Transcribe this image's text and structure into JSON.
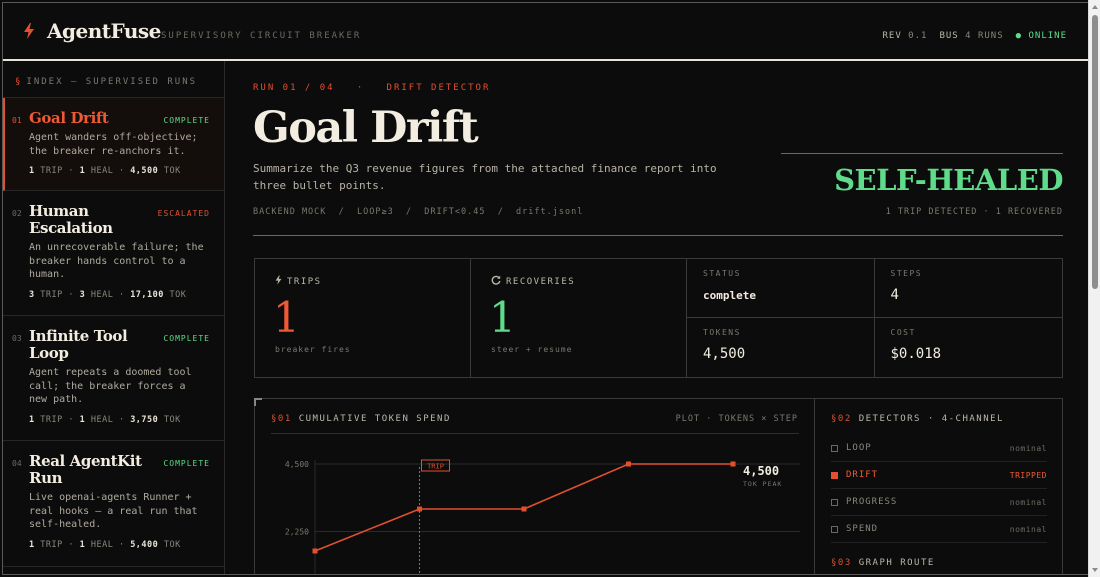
{
  "header": {
    "brand": "AgentFuse",
    "tagline": "SUPERVISORY CIRCUIT BREAKER",
    "rev_label": "REV",
    "rev_value": "0.1",
    "bus_label": "BUS",
    "bus_value": "4 RUNS",
    "status": "● ONLINE",
    "logo_icon": "bolt-icon",
    "accent": "#e2502e"
  },
  "sidebar": {
    "title": "INDEX — SUPERVISED RUNS",
    "title_icon": "§",
    "runs": [
      {
        "num": "01",
        "title": "Goal Drift",
        "status": "COMPLETE",
        "desc": "Agent wanders off-objective; the breaker re-anchors it.",
        "trips": "1",
        "trip_label": "TRIP",
        "heals": "1",
        "heal_label": "HEAL",
        "tokens": "4,500",
        "tok_label": "TOK"
      },
      {
        "num": "02",
        "title": "Human Escalation",
        "status": "ESCALATED",
        "desc": "An unrecoverable failure; the breaker hands control to a human.",
        "trips": "3",
        "trip_label": "TRIP",
        "heals": "3",
        "heal_label": "HEAL",
        "tokens": "17,100",
        "tok_label": "TOK"
      },
      {
        "num": "03",
        "title": "Infinite Tool Loop",
        "status": "COMPLETE",
        "desc": "Agent repeats a doomed tool call; the breaker forces a new path.",
        "trips": "1",
        "trip_label": "TRIP",
        "heals": "1",
        "heal_label": "HEAL",
        "tokens": "3,750",
        "tok_label": "TOK"
      },
      {
        "num": "04",
        "title": "Real AgentKit Run",
        "status": "COMPLETE",
        "desc": "Live openai-agents Runner + real hooks — a real run that self-healed.",
        "trips": "1",
        "trip_label": "TRIP",
        "heals": "1",
        "heal_label": "HEAL",
        "tokens": "5,400",
        "tok_label": "TOK"
      }
    ]
  },
  "main": {
    "run_label": "RUN 01 / 04   ·   DRIFT DETECTOR",
    "title": "Goal Drift",
    "prompt": "Summarize the Q3 revenue figures from the attached finance report into three bullet points.",
    "tags": "BACKEND MOCK  /  LOOP≥3  /  DRIFT<0.45  /  drift.jsonl",
    "verdict": "SELF-HEALED",
    "verdict_sub": "1 TRIP DETECTED · 1 RECOVERED"
  },
  "stats": {
    "trips_label": "TRIPS",
    "trips_value": "1",
    "trips_caption": "breaker fires",
    "trips_icon": "bolt-icon",
    "recoveries_label": "RECOVERIES",
    "recoveries_value": "1",
    "recoveries_caption": "steer + resume",
    "recoveries_icon": "refresh-icon",
    "status_label": "STATUS",
    "status_value": "complete",
    "steps_label": "STEPS",
    "steps_value": "4",
    "tokens_label": "TOKENS",
    "tokens_value": "4,500",
    "cost_label": "COST",
    "cost_value": "$0.018"
  },
  "chart_panel": {
    "num": "§01",
    "title": "CUMULATIVE TOKEN SPEND",
    "right_label": "PLOT · TOKENS × STEP",
    "peak_value": "4,500",
    "peak_label": "TOK PEAK",
    "trip_marker": "TRIP"
  },
  "chart_data": {
    "type": "line",
    "x": [
      0,
      1,
      2,
      3,
      4
    ],
    "series": [
      {
        "values": [
          1600,
          3000,
          3000,
          4500,
          4500
        ]
      }
    ],
    "yticks": [
      "4,500",
      "2,250"
    ],
    "ylim": [
      0,
      4500
    ],
    "annotations": [
      {
        "x": 1,
        "label": "TRIP"
      }
    ],
    "colors": {
      "line": "#e2502e",
      "grid": "#2a2a2a"
    }
  },
  "detectors": {
    "num": "§02",
    "title": "DETECTORS · 4-CHANNEL",
    "items": [
      {
        "name": "LOOP",
        "state": "nominal",
        "tripped": false
      },
      {
        "name": "DRIFT",
        "state": "TRIPPED",
        "tripped": true
      },
      {
        "name": "PROGRESS",
        "state": "nominal",
        "tripped": false
      },
      {
        "name": "SPEND",
        "state": "nominal",
        "tripped": false
      }
    ]
  },
  "graph": {
    "num": "§03",
    "title": "GRAPH ROUTE"
  }
}
